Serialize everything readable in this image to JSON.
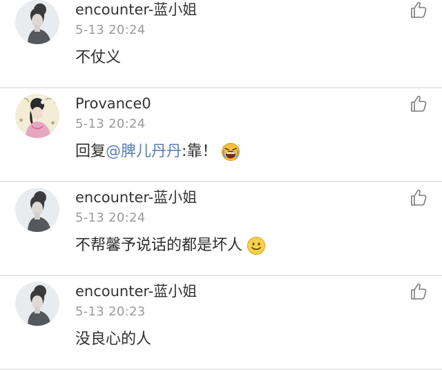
{
  "comments": [
    {
      "username": "encounter-蓝小姐",
      "time": "5-13 20:24",
      "text": "不仗义",
      "avatar": "woman-portrait-avatar"
    },
    {
      "username": "Provance0",
      "time": "5-13 20:24",
      "reply_prefix": "回复",
      "mention": "@脾儿丹丹",
      "text": ":靠！",
      "emoji": "crying-yelling-emoji",
      "avatar": "costume-portrait-avatar"
    },
    {
      "username": "encounter-蓝小姐",
      "time": "5-13 20:24",
      "text": "不帮馨予说话的都是坏人",
      "emoji": "smile-emoji",
      "avatar": "woman-portrait-avatar"
    },
    {
      "username": "encounter-蓝小姐",
      "time": "5-13 20:23",
      "text": "没良心的人",
      "avatar": "woman-portrait-avatar"
    }
  ],
  "colors": {
    "username": "#333333",
    "timestamp": "#9a9a9a",
    "mention": "#5b7fb3",
    "divider": "#e6e6e6"
  },
  "icons": {
    "like": "thumbs-up-icon"
  }
}
